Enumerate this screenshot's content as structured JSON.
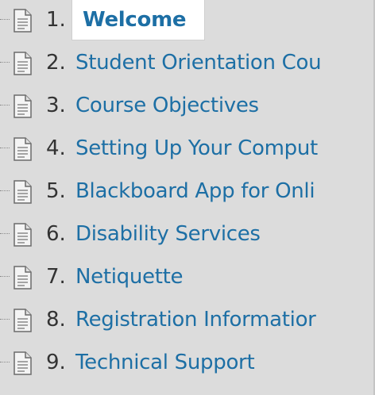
{
  "tree": {
    "items": [
      {
        "number": "1.",
        "label": "Welcome",
        "selected": true
      },
      {
        "number": "2.",
        "label": "Student Orientation Cou"
      },
      {
        "number": "3.",
        "label": "Course Objectives"
      },
      {
        "number": "4.",
        "label": "Setting Up Your Comput"
      },
      {
        "number": "5.",
        "label": "Blackboard App for Onli"
      },
      {
        "number": "6.",
        "label": "Disability Services"
      },
      {
        "number": "7.",
        "label": "Netiquette"
      },
      {
        "number": "8.",
        "label": "Registration Informatior"
      },
      {
        "number": "9.",
        "label": "Technical Support"
      }
    ]
  },
  "colors": {
    "background": "#dcdcdc",
    "link": "#1d6fa5",
    "number_text": "#333333",
    "selected_background": "#ffffff"
  },
  "icons": {
    "item_icon": "document-icon"
  }
}
